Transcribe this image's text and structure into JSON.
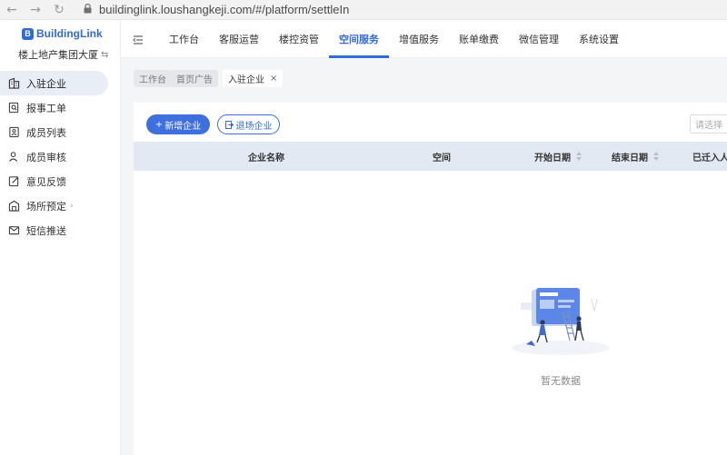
{
  "browser": {
    "url": "buildinglink.loushangkeji.com/#/platform/settleIn"
  },
  "brand": {
    "name": "BuildingLink",
    "logo_letter": "B",
    "organization": "楼上地产集团大厦",
    "accent": "#2f6bd9"
  },
  "sidebar": {
    "items": [
      {
        "label": "入驻企业",
        "icon": "building-icon",
        "active": true
      },
      {
        "label": "报事工单",
        "icon": "ticket-search-icon"
      },
      {
        "label": "成员列表",
        "icon": "member-list-icon"
      },
      {
        "label": "成员审核",
        "icon": "user-review-icon"
      },
      {
        "label": "意见反馈",
        "icon": "feedback-edit-icon"
      },
      {
        "label": "场所预定",
        "icon": "venue-booking-icon",
        "has_submenu": true
      },
      {
        "label": "短信推送",
        "icon": "mail-icon"
      }
    ]
  },
  "topnav": {
    "tabs": [
      {
        "label": "工作台"
      },
      {
        "label": "客服运营"
      },
      {
        "label": "楼控资管"
      },
      {
        "label": "空间服务",
        "active": true
      },
      {
        "label": "增值服务"
      },
      {
        "label": "账单缴费"
      },
      {
        "label": "微信管理"
      },
      {
        "label": "系统设置"
      }
    ]
  },
  "breadcrumbs": {
    "items": [
      {
        "label": "工作台"
      },
      {
        "label": "首页广告"
      },
      {
        "label": "入驻企业",
        "current": true
      }
    ]
  },
  "toolbar": {
    "add_label": "新增企业",
    "exit_label": "退场企业",
    "select_placeholder": "请选择"
  },
  "table": {
    "columns": [
      {
        "label": "企业名称"
      },
      {
        "label": "空间"
      },
      {
        "label": "开始日期",
        "sortable": true
      },
      {
        "label": "结束日期",
        "sortable": true
      },
      {
        "label": "已迁入人"
      }
    ],
    "rows": [],
    "empty_text": "暂无数据"
  }
}
